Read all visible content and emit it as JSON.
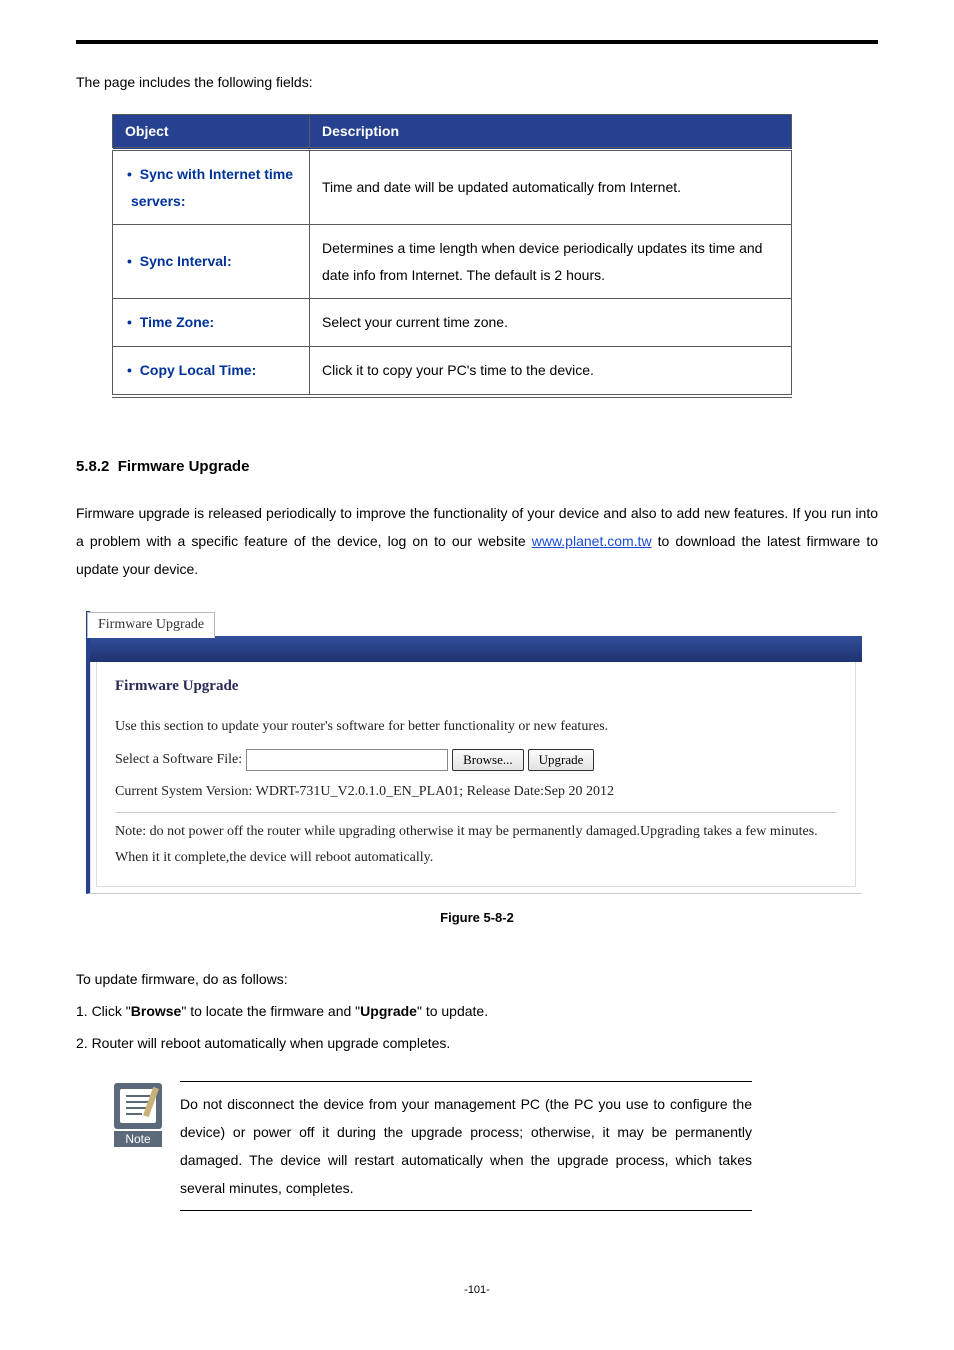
{
  "intro_text": "The page includes the following fields:",
  "table": {
    "headers": {
      "object": "Object",
      "description": "Description"
    },
    "rows": [
      {
        "object": "Sync with Internet time servers:",
        "description": "Time and date will be updated automatically from Internet."
      },
      {
        "object": "Sync Interval:",
        "description": "Determines a time length when device periodically updates its time and date info from Internet. The default is 2 hours."
      },
      {
        "object": "Time Zone:",
        "description": "Select your current time zone."
      },
      {
        "object": "Copy Local Time:",
        "description": "Click it to copy your PC's time to the device."
      }
    ]
  },
  "section": {
    "number": "5.8.2",
    "title": "Firmware Upgrade",
    "paragraph_pre": "Firmware upgrade is released periodically to improve the functionality of your device and also to add new features. If you run into a problem with a specific feature of the device, log on to our website ",
    "link_text": "www.planet.com.tw",
    "paragraph_post": " to download the latest firmware to update your device."
  },
  "screenshot": {
    "tab": "Firmware Upgrade",
    "heading": "Firmware Upgrade",
    "intro": "Use this section to update your router's software for better functionality or new features.",
    "file_label": "Select a Software File:",
    "browse_btn": "Browse...",
    "upgrade_btn": "Upgrade",
    "version_line": "Current System Version: WDRT-731U_V2.0.1.0_EN_PLA01; Release Date:Sep 20 2012",
    "note_line": "Note: do not power off the router while upgrading otherwise it may be permanently damaged.Upgrading takes a few minutes. When it it complete,the device will reboot automatically."
  },
  "figure_caption": "Figure 5-8-2",
  "steps": {
    "intro": "To update firmware, do as follows:",
    "s1_pre": "1. Click \"",
    "s1_b1": "Browse",
    "s1_mid": "\" to locate the firmware and \"",
    "s1_b2": "Upgrade",
    "s1_post": "\" to update.",
    "s2": "2. Router will reboot automatically when upgrade completes."
  },
  "note": {
    "icon_label": "Note",
    "text": "Do not disconnect the device from your management PC (the PC you use to configure the device) or power off it during the upgrade process; otherwise, it may be permanently damaged. The device will restart automatically when the upgrade process, which takes several minutes, completes."
  },
  "page_number": "-101-"
}
